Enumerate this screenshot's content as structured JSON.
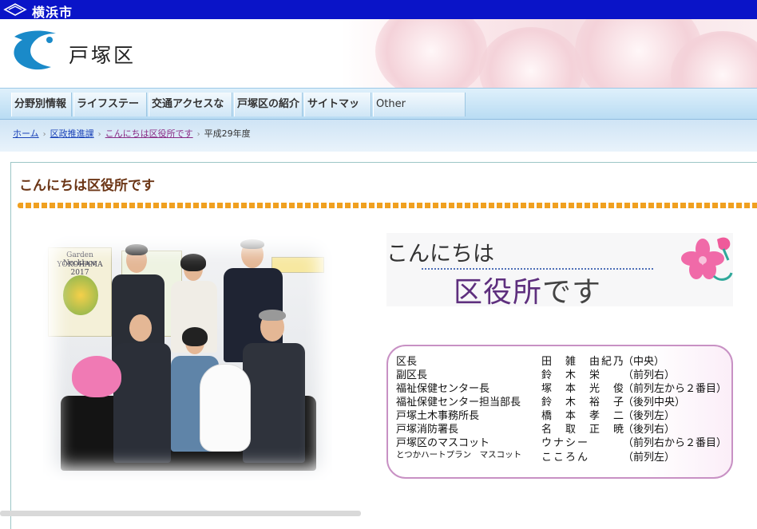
{
  "city": {
    "name": "横浜市"
  },
  "header": {
    "ward_name": "戸塚区"
  },
  "nav": {
    "items": [
      {
        "label": "分野別情報"
      },
      {
        "label": "ライフステージ"
      },
      {
        "label": "交通アクセスなど"
      },
      {
        "label": "戸塚区の紹介"
      },
      {
        "label": "サイトマップ"
      },
      {
        "label": "Other Languages"
      }
    ]
  },
  "breadcrumb": {
    "items": [
      {
        "label": "ホーム"
      },
      {
        "label": "区政推進課"
      },
      {
        "label": "こんにちは区役所です"
      }
    ],
    "current": "平成29年度"
  },
  "page": {
    "title": "こんにちは区役所です",
    "photo_text": {
      "poster": "Garden Necklace",
      "poster_sub": "YOKOHAMA 2017"
    },
    "greeting": {
      "line1": "こんにちは",
      "line2_purple": "区役所",
      "line2_rest": "です"
    },
    "members": [
      {
        "role": "区長",
        "name": "田　雑　由紀乃",
        "position": "（中央）"
      },
      {
        "role": "副区長",
        "name": "鈴　木　栄",
        "position": "（前列右）"
      },
      {
        "role": "福祉保健センター長",
        "name": "塚　本　光　俊",
        "position": "（前列左から２番目）"
      },
      {
        "role": "福祉保健センター担当部長",
        "name": "鈴　木　裕　子",
        "position": "（後列中央）"
      },
      {
        "role": "戸塚土木事務所長",
        "name": "橋　本　孝　二",
        "position": "（後列左）"
      },
      {
        "role": "戸塚消防署長",
        "name": "名　取　正　暁",
        "position": "（後列右）"
      },
      {
        "role": "戸塚区のマスコット",
        "name": "ウナシー",
        "position": "（前列右から２番目）"
      },
      {
        "role": "とつかハートプラン　マスコット",
        "name": "こころん",
        "position": "（前列左）"
      }
    ]
  },
  "colors": {
    "city_bar": "#0a14c8",
    "title": "#6b3515",
    "dots": "#f0a020",
    "frame": "#c891c4"
  }
}
